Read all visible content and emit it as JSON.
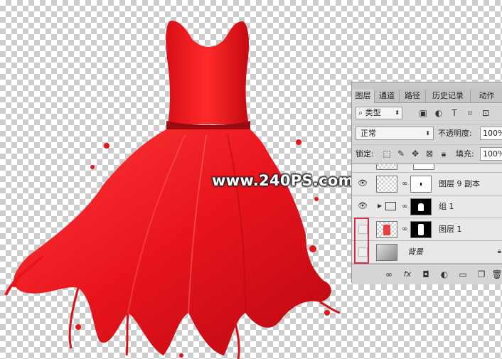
{
  "watermark": "www.240PS.com",
  "layers_panel": {
    "tabs": [
      "图层",
      "通道",
      "路径",
      "历史记录",
      "动作"
    ],
    "kind_filter": "类型",
    "blend_mode": "正常",
    "opacity_label": "不透明度:",
    "opacity_value": "100%",
    "lock_label": "锁定:",
    "fill_label": "填充:",
    "fill_value": "100%",
    "layers": [
      {
        "name": "图层 9 副本",
        "visible": true
      },
      {
        "name": "组 1",
        "visible": true,
        "type": "group"
      },
      {
        "name": "图层 1",
        "visible": false
      },
      {
        "name": "背景",
        "visible": false,
        "locked": true
      }
    ]
  },
  "colors": {
    "dress_red": "#e8141c",
    "highlight_box": "#e0284b",
    "panel_bg": "#d6d6d6"
  }
}
